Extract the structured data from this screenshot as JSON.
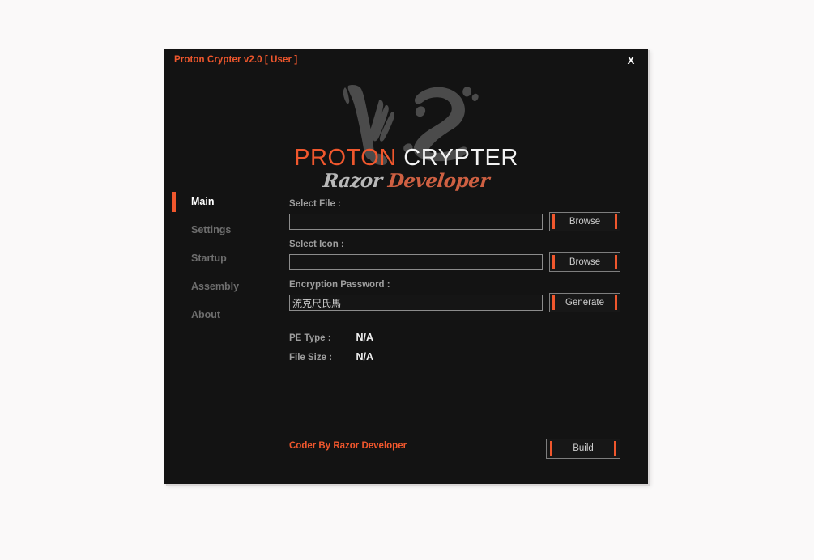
{
  "window": {
    "title": "Proton Crypter v2.0 [ User ]",
    "close_label": "X",
    "accent_color": "#f0572d",
    "background_color": "#131313"
  },
  "logo": {
    "watermark_text": "V2",
    "name_primary": "PROTON",
    "name_secondary": "CRYPTER",
    "tagline_primary": "Razor",
    "tagline_secondary": "Developer"
  },
  "sidebar": {
    "items": [
      {
        "label": "Main",
        "active": true
      },
      {
        "label": "Settings",
        "active": false
      },
      {
        "label": "Startup",
        "active": false
      },
      {
        "label": "Assembly",
        "active": false
      },
      {
        "label": "About",
        "active": false
      }
    ]
  },
  "main": {
    "fields": [
      {
        "label": "Select File :",
        "value": "",
        "placeholder": "",
        "button": "Browse"
      },
      {
        "label": "Select Icon :",
        "value": "",
        "placeholder": "",
        "button": "Browse"
      },
      {
        "label": "Encryption Password :",
        "value": "流克尺氏馬",
        "placeholder": "",
        "button": "Generate"
      }
    ],
    "info": [
      {
        "label": "PE Type :",
        "value": "N/A"
      },
      {
        "label": "File Size :",
        "value": "N/A"
      }
    ]
  },
  "footer": {
    "credit": "Coder By Razor Developer",
    "build_label": "Build"
  }
}
